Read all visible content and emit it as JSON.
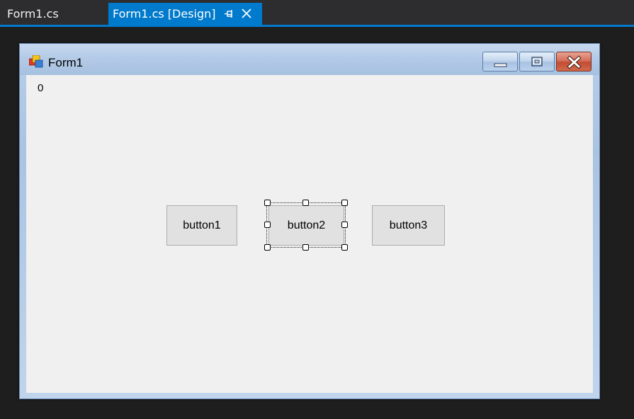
{
  "tabs": {
    "inactive_label": "Form1.cs",
    "active_label": "Form1.cs [Design]",
    "active_pin_icon": "pin-icon",
    "active_close_icon": "close-icon",
    "accent_color": "#007acc"
  },
  "form": {
    "title": "Form1",
    "app_icon": "windows-forms-app-icon",
    "caption_buttons": {
      "minimize_icon": "minimize-icon",
      "maximize_icon": "maximize-icon",
      "close_icon": "close-icon"
    },
    "label_value": "0",
    "buttons": [
      {
        "label": "button1"
      },
      {
        "label": "button2",
        "selected": true
      },
      {
        "label": "button3"
      }
    ]
  }
}
